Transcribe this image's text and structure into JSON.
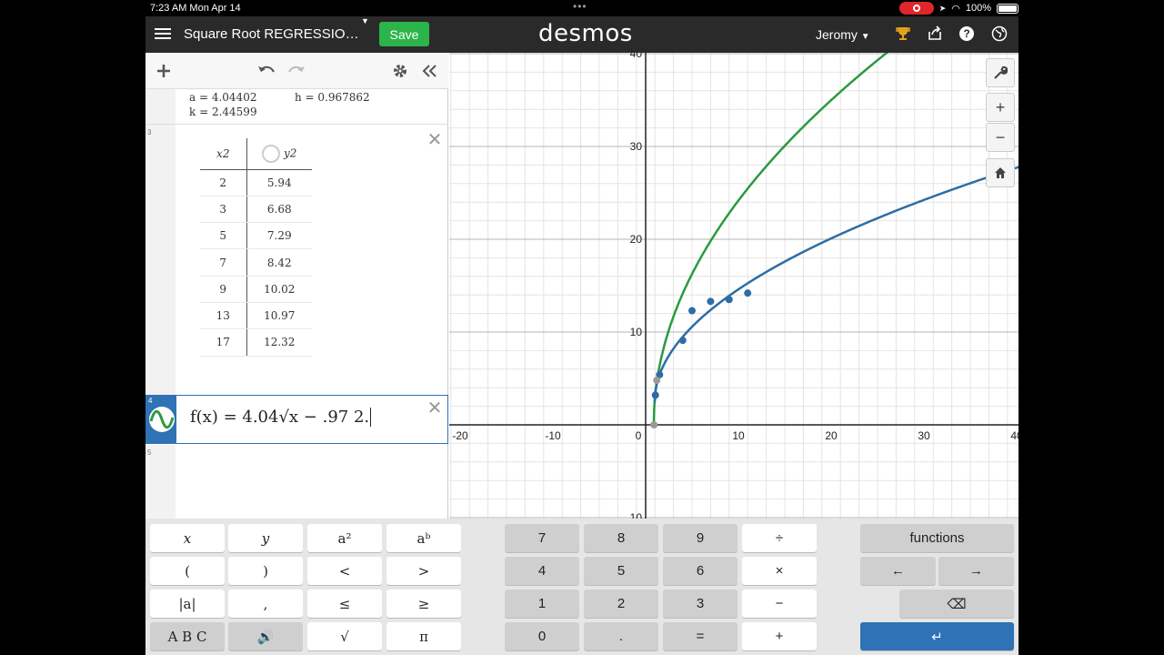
{
  "status_bar": {
    "time_date": "7:23 AM   Mon Apr 14",
    "battery": "100%"
  },
  "header": {
    "title": "Square Root REGRESSIO…",
    "save_label": "Save",
    "logo": "desmos",
    "user": "Jeromy"
  },
  "expressions": {
    "regression_values": {
      "a": "a = 4.04402",
      "h": "h = 0.967862",
      "k": "k = 2.44599"
    },
    "line_numbers": [
      "3",
      "4",
      "5"
    ],
    "table": {
      "headers": [
        "x2",
        "y2"
      ],
      "rows": [
        [
          "2",
          "5.94"
        ],
        [
          "3",
          "6.68"
        ],
        [
          "5",
          "7.29"
        ],
        [
          "7",
          "8.42"
        ],
        [
          "9",
          "10.02"
        ],
        [
          "13",
          "10.97"
        ],
        [
          "17",
          "12.32"
        ]
      ]
    },
    "expr4": {
      "latex": "f(x) = 4.04√x − .97 2."
    }
  },
  "graph": {
    "x_ticks": [
      "-20",
      "-10",
      "0",
      "10",
      "20",
      "30",
      "40"
    ],
    "y_ticks": [
      "40",
      "30",
      "20",
      "10",
      "10"
    ],
    "curve_colors": {
      "green": "#2b9a3f",
      "blue": "#2d6da4"
    }
  },
  "keypad": {
    "left": [
      [
        "x",
        "y",
        "a²",
        "aᵇ"
      ],
      [
        "(",
        ")",
        "<",
        ">"
      ],
      [
        "|a|",
        ",",
        "≤",
        "≥"
      ],
      [
        "A B C",
        "🔊",
        "√",
        "π"
      ]
    ],
    "mid": [
      [
        "7",
        "8",
        "9",
        "÷"
      ],
      [
        "4",
        "5",
        "6",
        "×"
      ],
      [
        "1",
        "2",
        "3",
        "−"
      ],
      [
        "0",
        ".",
        "=",
        "+"
      ]
    ],
    "functions": "functions",
    "left_arrow": "←",
    "right_arrow": "→",
    "backspace": "⌫",
    "enter": "↵"
  }
}
